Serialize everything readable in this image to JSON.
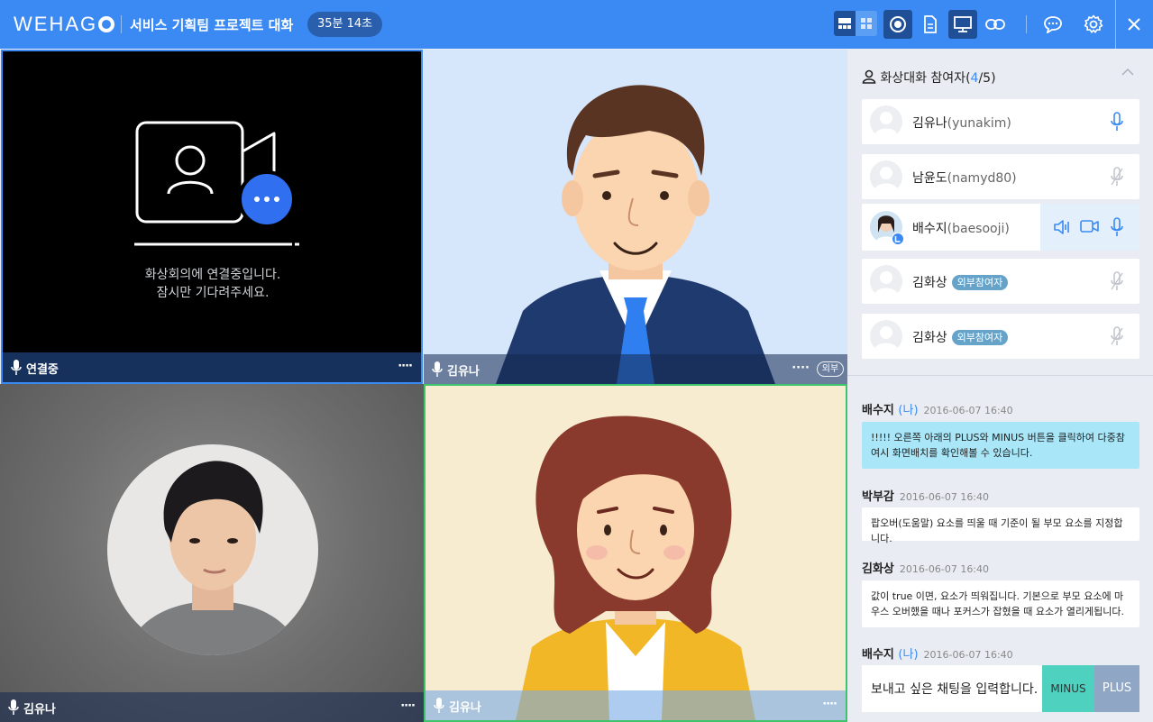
{
  "header": {
    "logo": "WEHAG",
    "room_title": "서비스 기획팀 프로젝트 대화",
    "timer": "35분 14초"
  },
  "tiles": [
    {
      "name": "연결중",
      "status_line1": "화상회의에 연결중입니다.",
      "status_line2": "잠시만 기다려주세요.",
      "more": "····"
    },
    {
      "name": "김유나",
      "more": "····",
      "ext": "외부"
    },
    {
      "name": "김유나",
      "more": "····"
    },
    {
      "name": "김유나",
      "more": "····"
    }
  ],
  "participants": {
    "title": "화상대화 참여자(",
    "count_current": "4",
    "count_total": "/5)",
    "list": [
      {
        "name": "김유나",
        "id": "(yunakim)",
        "badge": "",
        "mic": "on"
      },
      {
        "name": "남윤도",
        "id": "(namyd80)",
        "badge": "",
        "mic": "off"
      },
      {
        "name": "배수지",
        "id": "(baesooji)",
        "badge": "",
        "mic": "on"
      },
      {
        "name": "김화상",
        "id": "",
        "badge": "외부참여자",
        "mic": "off"
      },
      {
        "name": "김화상",
        "id": "",
        "badge": "외부참여자",
        "mic": "off"
      }
    ]
  },
  "chat": [
    {
      "sender": "배수지",
      "me": "(나)",
      "time": "2016-06-07 16:40",
      "text": "!!!!! 오른쪽 아래의 PLUS와 MINUS 버튼을 클릭하여 다중참여시 화면배치를 확인해볼 수 있습니다."
    },
    {
      "sender": "박부감",
      "me": "",
      "time": "2016-06-07 16:40",
      "text": "팝오버(도움말) 요소를 띄울 때 기준이 될 부모 요소를 지정합니다."
    },
    {
      "sender": "김화상",
      "me": "",
      "time": "2016-06-07 16:40",
      "text": "값이 true 이면, 요소가 띄워집니다. 기본으로 부모 요소에 마우스 오버했을 때나 포커스가 잡혔을 때 요소가 열리게됩니다."
    },
    {
      "sender": "배수지",
      "me": "(나)",
      "time": "2016-06-07 16:40",
      "text": ""
    }
  ],
  "chat_input": {
    "placeholder": "보내고 싶은 채팅을 입력합니다.",
    "minus_label": "MINUS",
    "plus_label": "PLUS"
  },
  "colors": {
    "header": "#3b8af3",
    "accent": "#3b8af3",
    "minus": "#4fd1c0",
    "plus": "#8fa6c4",
    "my_message": "#a8e6f8"
  }
}
